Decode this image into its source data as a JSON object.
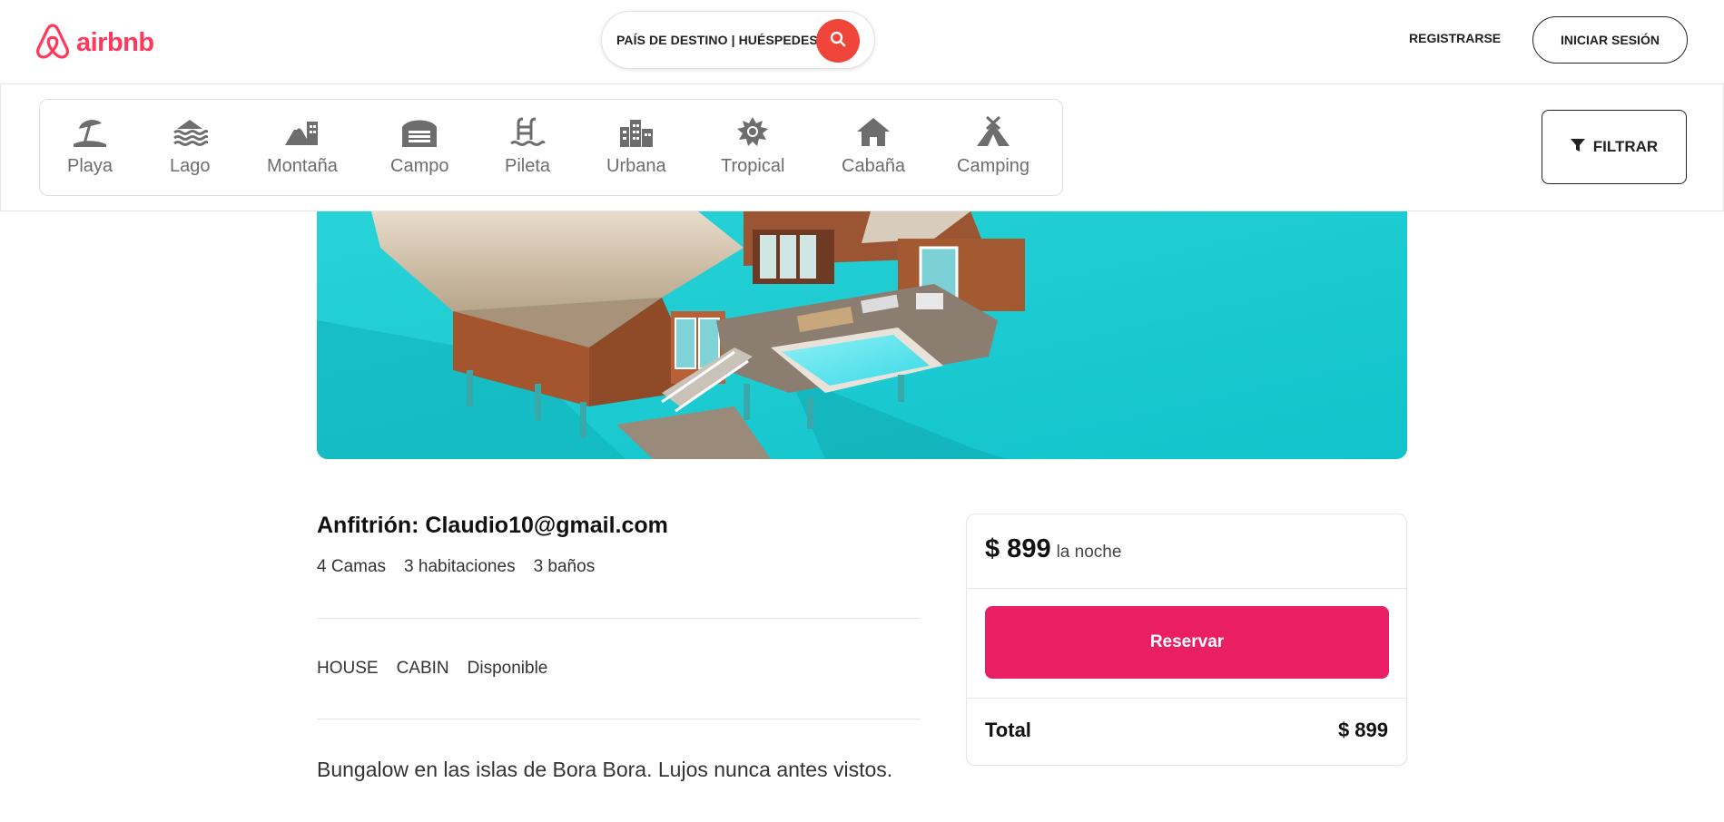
{
  "header": {
    "logo_text": "airbnb",
    "search_placeholder": "PAÍS DE DESTINO | HUÉSPEDES",
    "register_label": "REGISTRARSE",
    "login_label": "INICIAR SESIÓN"
  },
  "categories": [
    {
      "label": "Playa",
      "icon": "beach-umbrella-icon"
    },
    {
      "label": "Lago",
      "icon": "lake-icon"
    },
    {
      "label": "Montaña",
      "icon": "mountain-icon"
    },
    {
      "label": "Campo",
      "icon": "barn-icon"
    },
    {
      "label": "Pileta",
      "icon": "pool-ladder-icon"
    },
    {
      "label": "Urbana",
      "icon": "city-icon"
    },
    {
      "label": "Tropical",
      "icon": "sun-icon"
    },
    {
      "label": "Cabaña",
      "icon": "house-icon"
    },
    {
      "label": "Camping",
      "icon": "tent-icon"
    }
  ],
  "filter_label": "FILTRAR",
  "listing": {
    "host": "Anfitrión: Claudio10@gmail.com",
    "meta": [
      "4 Camas",
      "3 habitaciones",
      "3 baños"
    ],
    "tags": [
      "HOUSE",
      "CABIN",
      "Disponible"
    ],
    "description": "Bungalow en las islas de Bora Bora. Lujos nunca antes vistos."
  },
  "booking": {
    "price": "$ 899",
    "unit": "la noche",
    "reserve_label": "Reservar",
    "total_label": "Total",
    "total_value": "$ 899"
  },
  "colors": {
    "brand": "#ff385c",
    "search_button": "#f0453a",
    "reserve_button": "#e91e63"
  }
}
